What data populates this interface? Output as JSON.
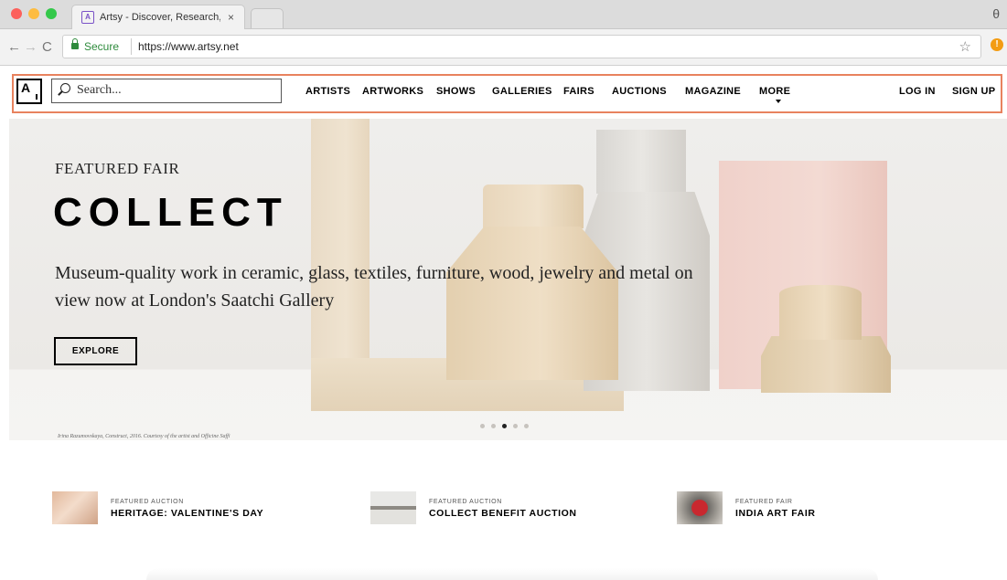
{
  "browser": {
    "tab_title": "Artsy - Discover, Research, an",
    "tab_close": "×",
    "secure_label": "Secure",
    "url": "https://www.artsy.net",
    "back_icon": "←",
    "forward_icon": "→",
    "reload_icon": "C",
    "star_icon": "☆",
    "profile_icon": "θ"
  },
  "header": {
    "logo": "A",
    "search_placeholder": "Search...",
    "nav": [
      "ARTISTS",
      "ARTWORKS",
      "SHOWS",
      "GALLERIES",
      "FAIRS",
      "AUCTIONS",
      "MAGAZINE",
      "MORE"
    ],
    "login": "LOG IN",
    "signup": "SIGN UP",
    "highlight_color": "#e8825e"
  },
  "hero": {
    "eyebrow": "FEATURED FAIR",
    "title": "COLLECT",
    "description": "Museum-quality work in ceramic, glass, textiles, furniture, wood, jewelry and metal on view now at London's Saatchi Gallery",
    "cta": "EXPLORE",
    "credit": "Irina Razumovskaya, Construct, 2016. Courtesy of the artist and Officine Saffi",
    "slide_count": 5,
    "active_slide": 3
  },
  "featured": [
    {
      "kicker": "FEATURED AUCTION",
      "title": "HERITAGE: VALENTINE'S DAY"
    },
    {
      "kicker": "FEATURED AUCTION",
      "title": "COLLECT BENEFIT AUCTION"
    },
    {
      "kicker": "FEATURED FAIR",
      "title": "INDIA ART FAIR"
    }
  ]
}
